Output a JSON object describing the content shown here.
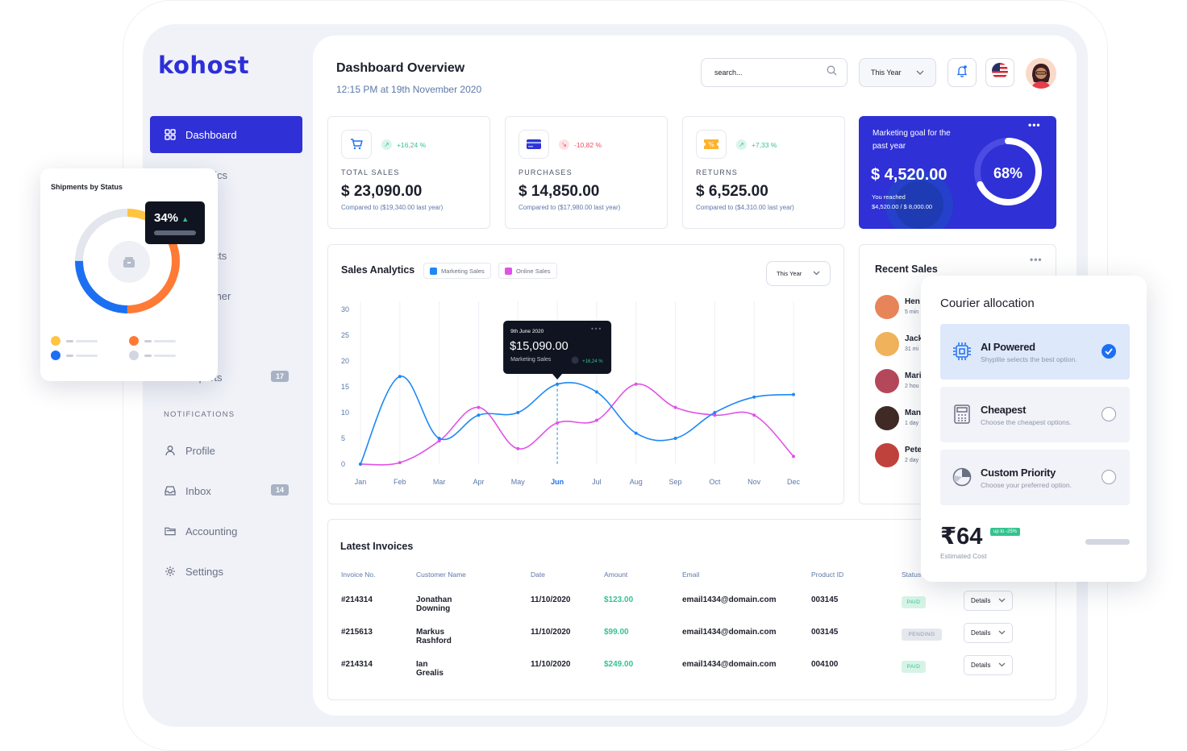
{
  "app": {
    "logo": "kohost",
    "title": "Dashboard Overview",
    "subtitle": "12:15 PM at 19th November 2020"
  },
  "header": {
    "search_placeholder": "search...",
    "period": "This Year"
  },
  "sidebar": {
    "items": [
      {
        "label": "Dashboard",
        "icon": "grid-icon",
        "active": true
      },
      {
        "label": "Analytics",
        "icon": "chart-icon"
      },
      {
        "label": "Products",
        "icon": "box-icon"
      },
      {
        "label": "Customer",
        "icon": "user-icon"
      },
      {
        "label": "Reports",
        "icon": "file-icon",
        "badge": "17"
      }
    ],
    "section_label": "NOTIFICATIONS",
    "notification_items": [
      {
        "label": "Profile",
        "icon": "user-icon"
      },
      {
        "label": "Inbox",
        "icon": "inbox-icon",
        "badge": "14"
      },
      {
        "label": "Accounting",
        "icon": "folder-icon"
      },
      {
        "label": "Settings",
        "icon": "gear-icon"
      }
    ]
  },
  "stats": [
    {
      "label": "TOTAL SALES",
      "value": "$ 23,090.00",
      "trend": "+16,24 %",
      "trend_dir": "up",
      "compare": "Compared to ($19,340.00 last year)",
      "icon": "cart-icon"
    },
    {
      "label": "PURCHASES",
      "value": "$ 14,850.00",
      "trend": "-10,82 %",
      "trend_dir": "down",
      "compare": "Compared to ($17,980.00 last year)",
      "icon": "card-icon"
    },
    {
      "label": "RETURNS",
      "value": "$ 6,525.00",
      "trend": "+7,33 %",
      "trend_dir": "up",
      "compare": "Compared to ($4,310.00 last year)",
      "icon": "ticket-icon"
    }
  ],
  "goal": {
    "title": "Marketing goal for the past year",
    "amount": "$ 4,520.00",
    "reached_label": "You reached",
    "reached_value": "$4,520.00 / $ 8,000.00",
    "percent_text": "68%",
    "percent": 0.68
  },
  "analytics": {
    "title": "Sales Analytics",
    "legend": [
      "Marketing Sales",
      "Online Sales"
    ],
    "period": "This Year",
    "tooltip": {
      "date": "9th June 2020",
      "value": "$15,090.00",
      "label": "Marketing Sales",
      "change": "+16,24 %"
    }
  },
  "chart_data": {
    "type": "line",
    "x": [
      "Jan",
      "Feb",
      "Mar",
      "Apr",
      "May",
      "Jun",
      "Jul",
      "Aug",
      "Sep",
      "Oct",
      "Nov",
      "Dec"
    ],
    "highlight_x": "Jun",
    "yticks": [
      0,
      5,
      10,
      15,
      20,
      25,
      30
    ],
    "ylim": [
      0,
      30
    ],
    "colors": {
      "Marketing Sales": "#1e88f5",
      "Online Sales": "#e052e6"
    },
    "series": [
      {
        "name": "Marketing Sales",
        "values": [
          0,
          17,
          5,
          9.5,
          10,
          15.5,
          14,
          6,
          5,
          10,
          13,
          13.5
        ]
      },
      {
        "name": "Online Sales",
        "values": [
          0,
          0.3,
          4.5,
          11,
          3,
          8,
          8.5,
          15.5,
          11,
          9.5,
          9.5,
          1.5
        ]
      }
    ]
  },
  "recent_sales": {
    "title": "Recent Sales",
    "items": [
      {
        "name": "Hen",
        "time": "5 min"
      },
      {
        "name": "Jack",
        "time": "31 mi"
      },
      {
        "name": "Mari",
        "time": "2 hou"
      },
      {
        "name": "Man",
        "time": "1 day"
      },
      {
        "name": "Pete",
        "time": "2 day"
      }
    ]
  },
  "invoices": {
    "title": "Latest Invoices",
    "columns": [
      "Invoice No.",
      "Customer Name",
      "Date",
      "Amount",
      "Email",
      "Product ID",
      "Status"
    ],
    "details_label": "Details",
    "rows": [
      {
        "no": "#214314",
        "customer": "Jonathan Downing",
        "date": "11/10/2020",
        "amount": "$123.00",
        "email": "email1434@domain.com",
        "product": "003145",
        "status": "PAID"
      },
      {
        "no": "#215613",
        "customer": "Markus Rashford",
        "date": "11/10/2020",
        "amount": "$99.00",
        "email": "email1434@domain.com",
        "product": "003145",
        "status": "PENDING"
      },
      {
        "no": "#214314",
        "customer": "Ian Grealis",
        "date": "11/10/2020",
        "amount": "$249.00",
        "email": "email1434@domain.com",
        "product": "004100",
        "status": "PAID"
      }
    ]
  },
  "shipments": {
    "title": "Shipments by Status",
    "percent_text": "34%",
    "segments": [
      {
        "name": "yellow",
        "value": 0.12,
        "color": "#ffc542"
      },
      {
        "name": "orange",
        "value": 0.38,
        "color": "#ff7a35"
      },
      {
        "name": "blue",
        "value": 0.25,
        "color": "#1d6ff2"
      },
      {
        "name": "grey",
        "value": 0.25,
        "color": "#e3e6ed"
      }
    ]
  },
  "courier": {
    "title": "Courier allocation",
    "options": [
      {
        "name": "AI Powered",
        "desc": "Shyplite selects the best option.",
        "selected": true,
        "icon": "chip-icon"
      },
      {
        "name": "Cheapest",
        "desc": "Choose the cheapest options.",
        "selected": false,
        "icon": "calculator-icon"
      },
      {
        "name": "Custom Priority",
        "desc": "Choose your preferred option.",
        "selected": false,
        "icon": "pie-icon"
      }
    ],
    "cost": "₹64",
    "discount": "up to -25%",
    "cost_label": "Estimated Cost"
  }
}
